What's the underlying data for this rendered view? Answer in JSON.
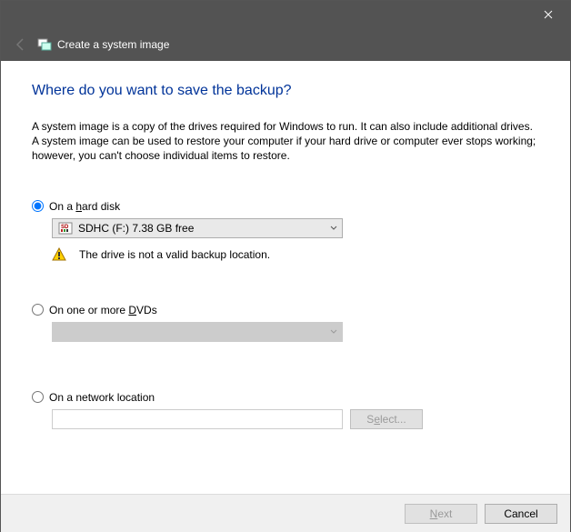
{
  "header": {
    "title": "Create a system image"
  },
  "page": {
    "title": "Where do you want to save the backup?",
    "intro": "A system image is a copy of the drives required for Windows to run. It can also include additional drives. A system image can be used to restore your computer if your hard drive or computer ever stops working; however, you can't choose individual items to restore."
  },
  "options": {
    "hard_disk": {
      "label_pre": "On a ",
      "mnemonic": "h",
      "label_post": "ard disk",
      "checked": true
    },
    "drive_selected": "SDHC (F:)  7.38 GB free",
    "warning": "The drive is not a valid backup location.",
    "dvd": {
      "label_pre": "On one or more ",
      "mnemonic": "D",
      "label_post": "VDs",
      "checked": false
    },
    "network": {
      "label": "On a network location",
      "checked": false,
      "value": ""
    }
  },
  "buttons": {
    "select_pre": "S",
    "select_mn": "e",
    "select_post": "lect...",
    "next_mn": "N",
    "next_post": "ext",
    "cancel": "Cancel"
  }
}
